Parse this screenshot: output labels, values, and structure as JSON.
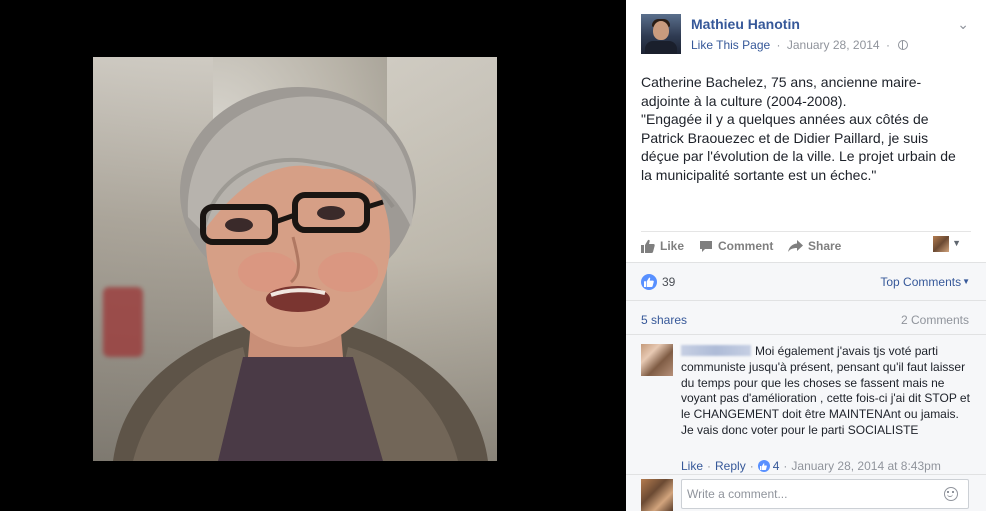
{
  "post": {
    "page_name": "Mathieu Hanotin",
    "like_page": "Like This Page",
    "separator": "·",
    "date": "January 28, 2014",
    "text": "Catherine Bachelez, 75 ans, ancienne maire-\nadjointe à la culture (2004-2008).\n\"Engagée il y a quelques années aux côtés de\nPatrick Braouezec et de Didier Paillard, je suis\ndéçue par l'évolution de la ville. Le projet urbain de\nla municipalité sortante est un échec.\""
  },
  "actions": {
    "like": "Like",
    "comment": "Comment",
    "share": "Share"
  },
  "stats": {
    "likes": "39",
    "top_comments": "Top Comments",
    "shares": "5 shares",
    "comments": "2 Comments"
  },
  "comment": {
    "text": "Moi également j'avais tjs voté parti communiste jusqu'à présent, pensant qu'il faut laisser du temps pour que les choses se fassent mais ne voyant pas d'amélioration , cette fois-ci j'ai dit STOP et le CHANGEMENT doit être MAINTENAnt ou jamais. Je vais donc voter pour le parti SOCIALISTE",
    "like": "Like",
    "reply": "Reply",
    "like_count": "4",
    "timestamp": "January 28, 2014 at 8:43pm"
  },
  "composer": {
    "placeholder": "Write a comment..."
  },
  "colors": {
    "link": "#365899",
    "muted": "#90949c",
    "like_blue": "#5890ff",
    "viewer_bg": "#000000"
  }
}
